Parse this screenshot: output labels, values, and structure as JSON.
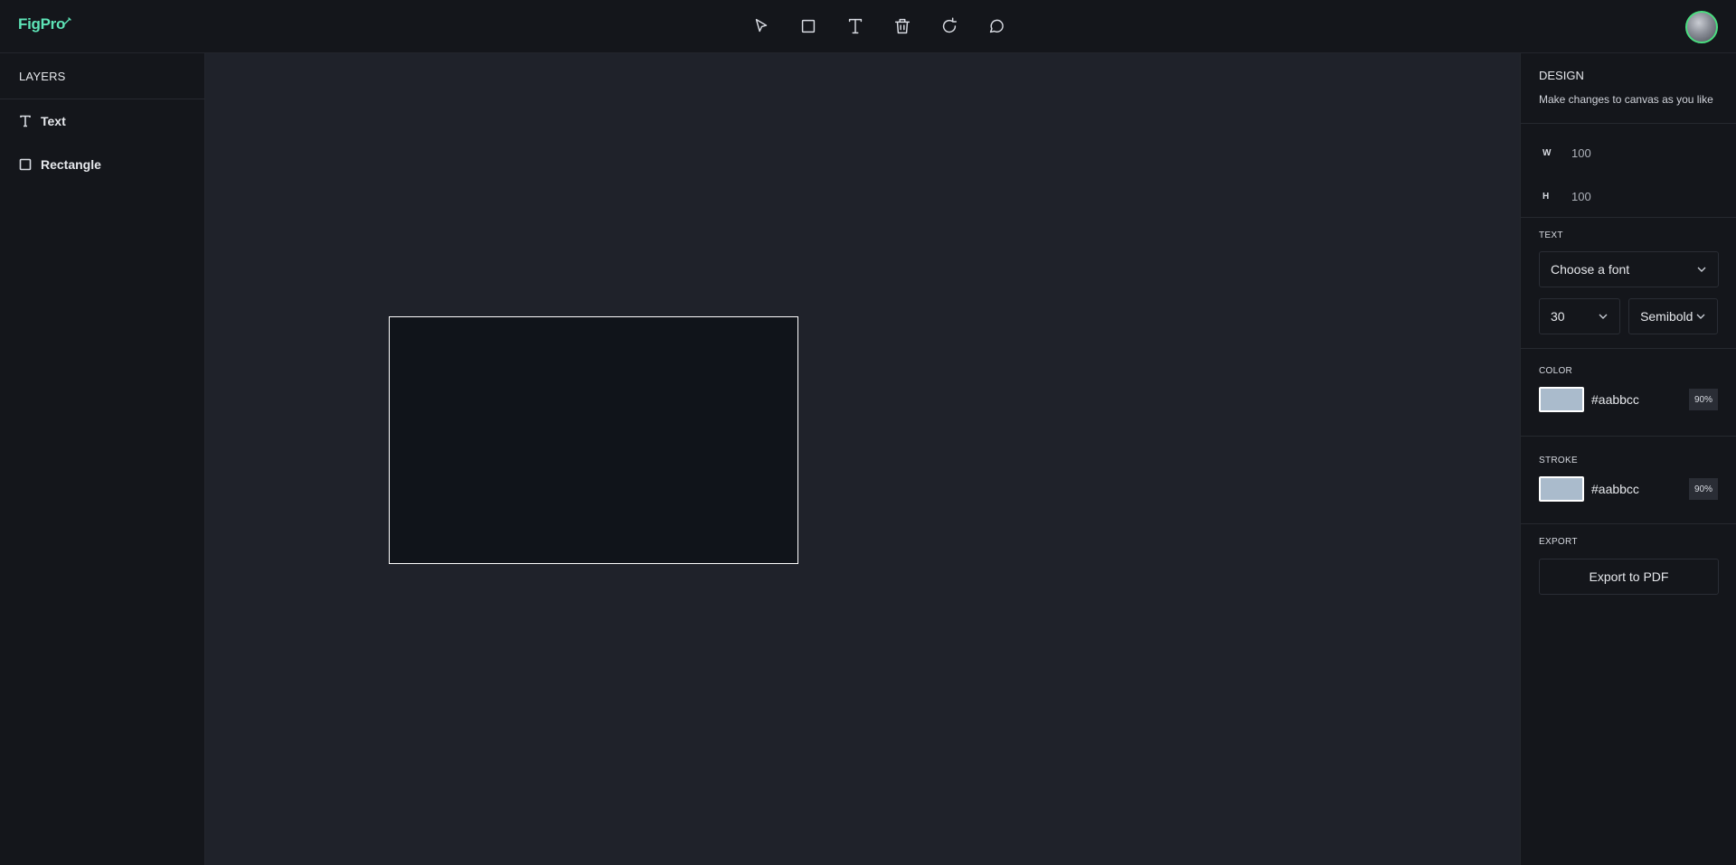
{
  "app": {
    "name": "FigPro"
  },
  "toolbar": {
    "tools": [
      {
        "id": "select",
        "icon": "cursor-icon"
      },
      {
        "id": "rectangle",
        "icon": "square-icon"
      },
      {
        "id": "text",
        "icon": "text-icon"
      },
      {
        "id": "delete",
        "icon": "trash-icon"
      },
      {
        "id": "reset",
        "icon": "refresh-icon"
      },
      {
        "id": "comments",
        "icon": "comment-icon"
      }
    ]
  },
  "user": {
    "avatar_border_color": "#4ade80"
  },
  "layers": {
    "heading": "LAYERS",
    "items": [
      {
        "label": "Text",
        "icon": "text-icon"
      },
      {
        "label": "Rectangle",
        "icon": "square-icon"
      }
    ]
  },
  "canvas": {
    "background": "#1f222a",
    "shapes": [
      {
        "type": "rectangle",
        "fill": "#10141a",
        "stroke": "#ffffff"
      }
    ]
  },
  "design": {
    "heading": "DESIGN",
    "subtitle": "Make changes to canvas as you like",
    "width": {
      "label": "W",
      "value": "100"
    },
    "height": {
      "label": "H",
      "value": "100"
    },
    "text": {
      "heading": "TEXT",
      "font_placeholder": "Choose a font",
      "font_size": "30",
      "font_weight": "Semibold"
    },
    "color": {
      "heading": "COLOR",
      "hex": "#aabbcc",
      "opacity": "90%"
    },
    "stroke": {
      "heading": "STROKE",
      "hex": "#aabbcc",
      "opacity": "90%"
    },
    "export": {
      "heading": "EXPORT",
      "button_label": "Export to PDF"
    }
  },
  "colors": {
    "accent": "#5ee4b7",
    "navbar_bg": "#14161b",
    "panel_bg": "#14161b"
  }
}
